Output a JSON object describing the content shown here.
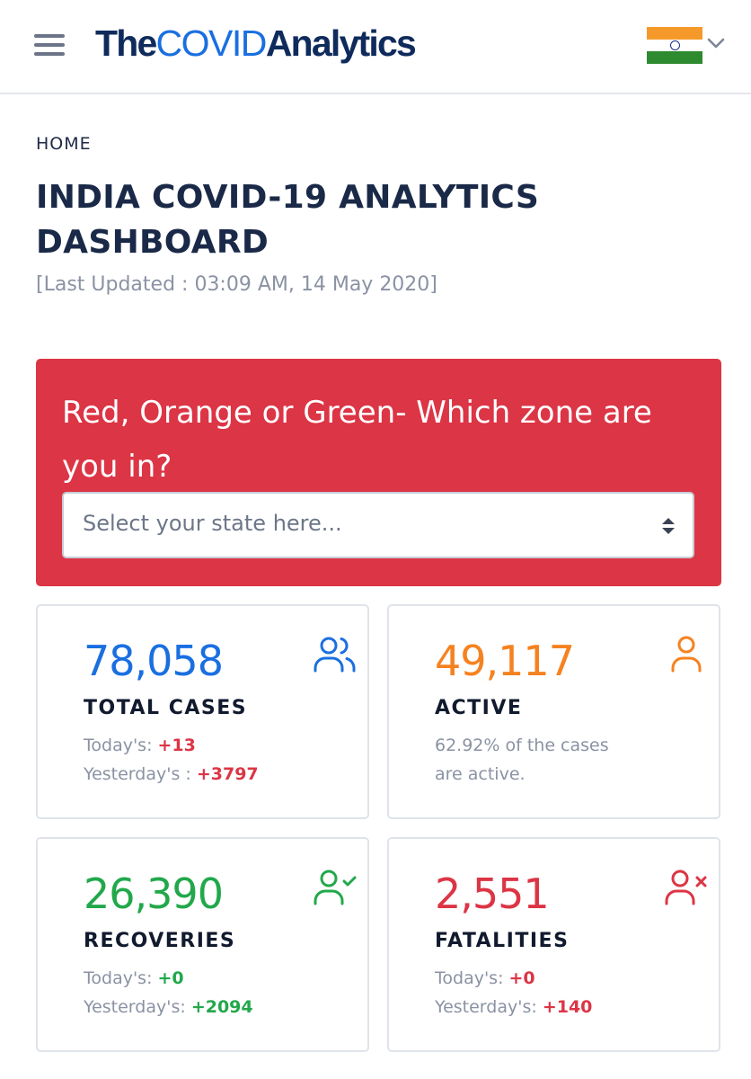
{
  "header": {
    "brand": {
      "part1": "The",
      "part2": "COVID",
      "part3": "Analytics"
    },
    "menu_icon": "hamburger-menu-icon",
    "flag_icon": "india-flag-icon",
    "chevron_icon": "chevron-down-icon"
  },
  "breadcrumb": "HOME",
  "page_title": "INDIA COVID-19 ANALYTICS DASHBOARD",
  "last_updated": "[Last Updated : 03:09 AM, 14 May 2020]",
  "zone": {
    "title": "Red, Orange or Green- Which zone are you in?",
    "select_placeholder": "Select your state here...",
    "background": "#dc3545"
  },
  "cards": {
    "total": {
      "value": "78,058",
      "label": "TOTAL CASES",
      "today_label": "Today's: ",
      "today_value": "+13",
      "yesterday_label": "Yesterday's : ",
      "yesterday_value": "+3797",
      "color": "#1a6fe0",
      "icon": "users-icon"
    },
    "active": {
      "value": "49,117",
      "label": "ACTIVE",
      "note1": "62.92% of the cases",
      "note2": "are active.",
      "color": "#f58220",
      "icon": "user-icon"
    },
    "recoveries": {
      "value": "26,390",
      "label": "RECOVERIES",
      "today_label": "Today's: ",
      "today_value": "+0",
      "yesterday_label": "Yesterday's: ",
      "yesterday_value": "+2094",
      "color": "#22a84b",
      "icon": "user-check-icon"
    },
    "fatalities": {
      "value": "2,551",
      "label": "FATALITIES",
      "today_label": "Today's: ",
      "today_value": "+0",
      "yesterday_label": "Yesterday's: ",
      "yesterday_value": "+140",
      "color": "#dc3545",
      "icon": "user-x-icon"
    }
  }
}
